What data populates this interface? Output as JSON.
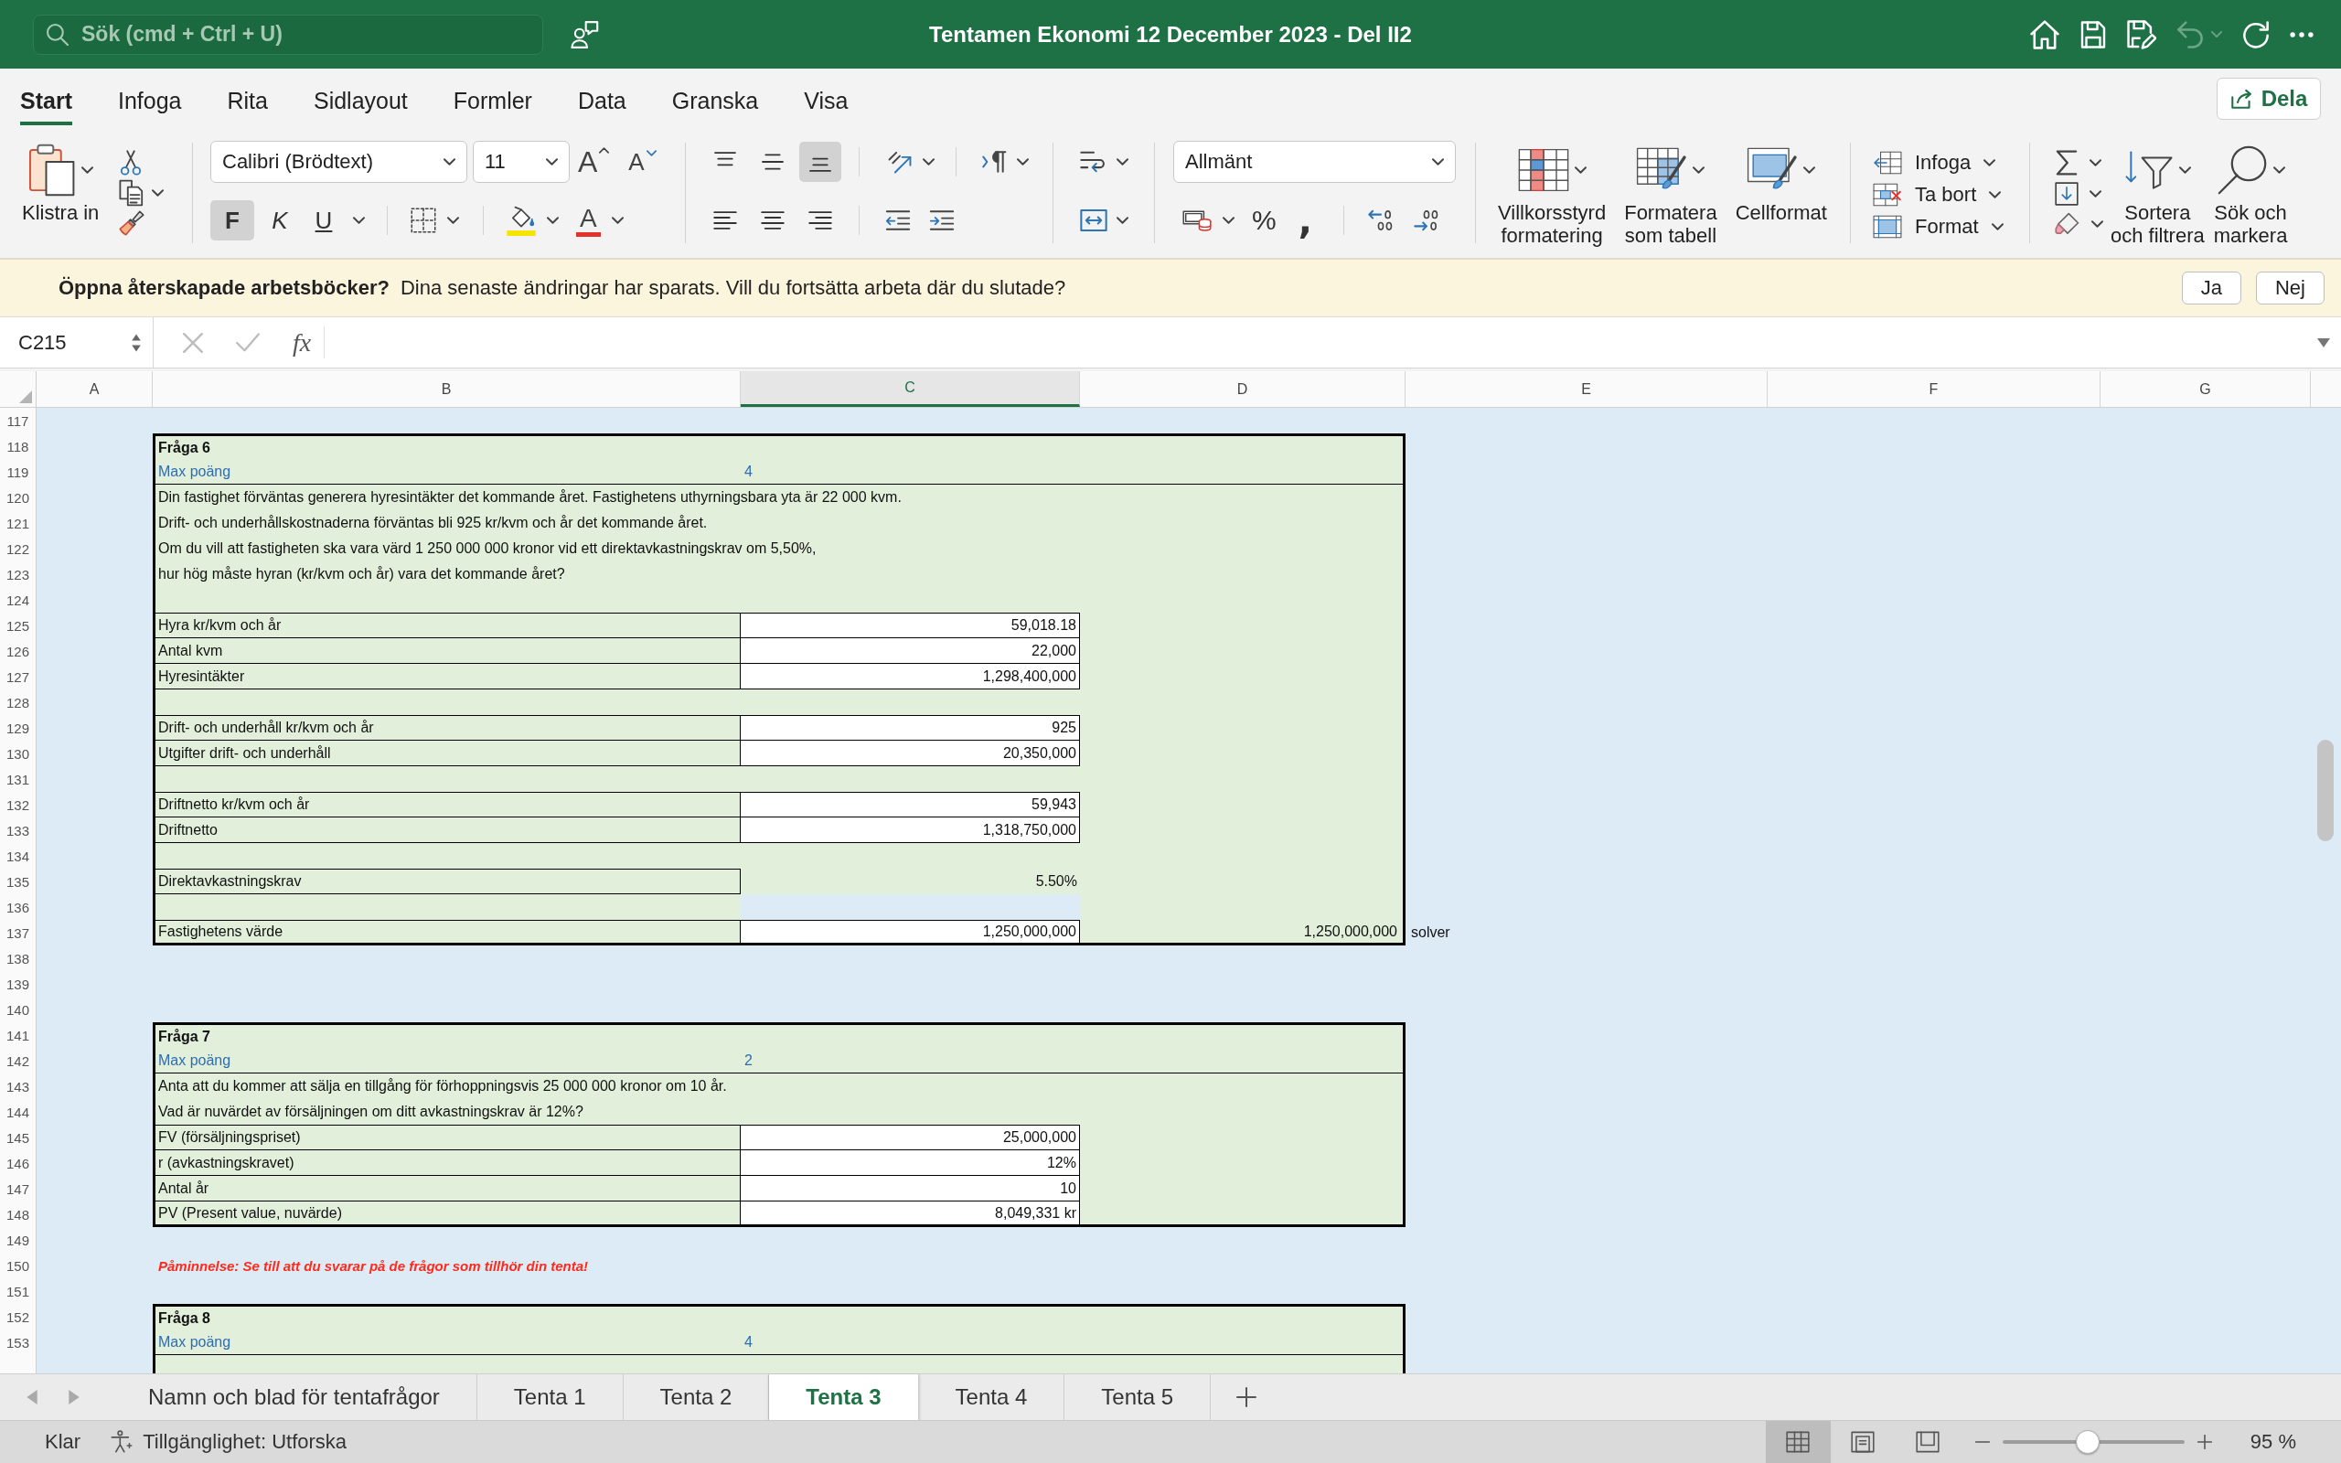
{
  "title_bar": {
    "search_placeholder": "Sök (cmd + Ctrl + U)",
    "title": "Tentamen Ekonomi 12 December 2023 - Del II2",
    "undo_disabled": true
  },
  "menu_tabs": [
    {
      "label": "Start",
      "selected": true
    },
    {
      "label": "Infoga",
      "selected": false
    },
    {
      "label": "Rita",
      "selected": false
    },
    {
      "label": "Sidlayout",
      "selected": false
    },
    {
      "label": "Formler",
      "selected": false
    },
    {
      "label": "Data",
      "selected": false
    },
    {
      "label": "Granska",
      "selected": false
    },
    {
      "label": "Visa",
      "selected": false
    }
  ],
  "share_button": "Dela",
  "ribbon": {
    "clipboard": {
      "paste_label": "Klistra in"
    },
    "font": {
      "font_name": "Calibri (Brödtext)",
      "font_size": "11",
      "grow_label": "A",
      "shrink_label": "A",
      "bold": {
        "label": "F",
        "on": true
      },
      "italic_label": "K",
      "underline_label": "U",
      "font_color_label": "A"
    },
    "alignment": {
      "vertical": [
        {
          "kind": "top",
          "selected": false
        },
        {
          "kind": "middle",
          "selected": false
        },
        {
          "kind": "bottom",
          "selected": true
        }
      ]
    },
    "number": {
      "format": "Allmänt",
      "percent_label": "%",
      "comma_label": ","
    },
    "styles": [
      {
        "kind": "conditional",
        "label_lines": [
          "Villkorsstyrd",
          "formatering"
        ]
      },
      {
        "kind": "table",
        "label_lines": [
          "Formatera",
          "som tabell"
        ]
      },
      {
        "kind": "cell",
        "label_lines": [
          "Cellformat"
        ]
      }
    ],
    "cells": [
      {
        "kind": "insert",
        "label": "Infoga"
      },
      {
        "kind": "delete",
        "label": "Ta bort"
      },
      {
        "kind": "format",
        "label": "Format"
      }
    ],
    "editing": {
      "sort_label_lines": [
        "Sortera",
        "och filtrera"
      ],
      "find_label_lines": [
        "Sök och",
        "markera"
      ]
    }
  },
  "notification": {
    "title": "Öppna återskapade arbetsböcker?",
    "message": "Dina senaste ändringar har sparats. Vill du fortsätta arbeta där du slutade?",
    "buttons": [
      "Ja",
      "Nej"
    ]
  },
  "formula_bar": {
    "name_box": "C215",
    "fx_label": "fx"
  },
  "columns": [
    {
      "label": "A",
      "selected": false
    },
    {
      "label": "B",
      "selected": false
    },
    {
      "label": "C",
      "selected": true
    },
    {
      "label": "D",
      "selected": false
    },
    {
      "label": "E",
      "selected": false
    },
    {
      "label": "F",
      "selected": false
    },
    {
      "label": "G",
      "selected": false
    }
  ],
  "blocks": [
    {
      "kind": "gap",
      "rows": [
        {
          "number": "117"
        }
      ]
    },
    {
      "kind": "question",
      "open_end": false,
      "rows": [
        {
          "number": "118",
          "kind": "title",
          "text": "Fråga 6"
        },
        {
          "number": "119",
          "kind": "points",
          "label": "Max poäng",
          "value": "4"
        },
        {
          "number": "120",
          "kind": "text",
          "text": "Din fastighet förväntas generera hyresintäkter det kommande året. Fastighetens uthyrningsbara yta är 22 000 kvm."
        },
        {
          "number": "121",
          "kind": "text",
          "text": "Drift- och underhållskostnaderna förväntas bli 925 kr/kvm och år det kommande året."
        },
        {
          "number": "122",
          "kind": "text",
          "text": "Om du vill att fastigheten ska vara värd 1 250 000 000 kronor vid ett direktavkastningskrav om 5,50%,"
        },
        {
          "number": "123",
          "kind": "text",
          "text": "hur hög måste hyran (kr/kvm och år) vara det kommande året?"
        },
        {
          "number": "124",
          "kind": "empty"
        },
        {
          "number": "125",
          "kind": "field",
          "label": "Hyra kr/kvm och år",
          "value": "59,018.18",
          "boxed": true
        },
        {
          "number": "126",
          "kind": "field",
          "label": "Antal kvm",
          "value": "22,000",
          "boxed": true
        },
        {
          "number": "127",
          "kind": "field",
          "label": "Hyresintäkter",
          "value": "1,298,400,000",
          "boxed": true
        },
        {
          "number": "128",
          "kind": "empty"
        },
        {
          "number": "129",
          "kind": "field",
          "label": "Drift- och underhåll kr/kvm och år",
          "value": "925",
          "boxed": true
        },
        {
          "number": "130",
          "kind": "field",
          "label": "Utgifter drift- och underhåll",
          "value": "20,350,000",
          "boxed": true
        },
        {
          "number": "131",
          "kind": "empty"
        },
        {
          "number": "132",
          "kind": "field",
          "label": "Driftnetto kr/kvm och år",
          "value": "59,943",
          "boxed": true
        },
        {
          "number": "133",
          "kind": "field",
          "label": "Driftnetto",
          "value": "1,318,750,000",
          "boxed": true
        },
        {
          "number": "134",
          "kind": "empty"
        },
        {
          "number": "135",
          "kind": "field",
          "label": "Direktavkastningskrav",
          "value": "5.50%",
          "boxed": false
        },
        {
          "number": "136",
          "kind": "empty",
          "unfilled_c": true
        },
        {
          "number": "137",
          "kind": "field",
          "label": "Fastighetens värde",
          "value": "1,250,000,000",
          "boxed": true,
          "column_d": "1,250,000,000",
          "column_e": "solver"
        }
      ]
    },
    {
      "kind": "gap",
      "rows": [
        {
          "number": "138"
        },
        {
          "number": "139"
        },
        {
          "number": "140"
        }
      ]
    },
    {
      "kind": "question",
      "open_end": false,
      "rows": [
        {
          "number": "141",
          "kind": "title",
          "text": "Fråga 7"
        },
        {
          "number": "142",
          "kind": "points",
          "label": "Max poäng",
          "value": "2"
        },
        {
          "number": "143",
          "kind": "text",
          "text": "Anta att du kommer att sälja en tillgång för förhoppningsvis 25 000 000 kronor om 10 år."
        },
        {
          "number": "144",
          "kind": "text",
          "text": "Vad är nuvärdet av försäljningen om ditt avkastningskrav är 12%?"
        },
        {
          "number": "145",
          "kind": "field",
          "label": "FV (försäljningspriset)",
          "value": "25,000,000",
          "boxed": true
        },
        {
          "number": "146",
          "kind": "field",
          "label": "r (avkastningskravet)",
          "value": "12%",
          "boxed": true
        },
        {
          "number": "147",
          "kind": "field",
          "label": "Antal år",
          "value": "10",
          "boxed": true
        },
        {
          "number": "148",
          "kind": "field",
          "label": "PV (Present value, nuvärde)",
          "value": "8,049,331 kr",
          "boxed": true
        }
      ]
    },
    {
      "kind": "gap",
      "rows": [
        {
          "number": "149"
        }
      ]
    },
    {
      "kind": "note",
      "rows": [
        {
          "number": "150",
          "text": "Påminnelse: Se till att du svarar på de frågor som tillhör din tenta!"
        }
      ]
    },
    {
      "kind": "gap",
      "rows": [
        {
          "number": "151"
        }
      ]
    },
    {
      "kind": "question",
      "open_end": true,
      "rows": [
        {
          "number": "152",
          "kind": "title",
          "text": "Fråga 8"
        },
        {
          "number": "153",
          "kind": "points",
          "label": "Max poäng",
          "value": "4"
        }
      ]
    }
  ],
  "sheet_tabs": [
    {
      "label": "Namn och blad för tentafrågor",
      "selected": false
    },
    {
      "label": "Tenta 1",
      "selected": false
    },
    {
      "label": "Tenta 2",
      "selected": false
    },
    {
      "label": "Tenta 3",
      "selected": true
    },
    {
      "label": "Tenta 4",
      "selected": false
    },
    {
      "label": "Tenta 5",
      "selected": false
    }
  ],
  "status_bar": {
    "status": "Klar",
    "accessibility": "Tillgänglighet: Utforska",
    "views": [
      {
        "kind": "normal",
        "selected": true
      },
      {
        "kind": "page_layout",
        "selected": false
      },
      {
        "kind": "page_break",
        "selected": false
      }
    ],
    "zoom": {
      "level": 0.47,
      "label": "95 %"
    }
  }
}
